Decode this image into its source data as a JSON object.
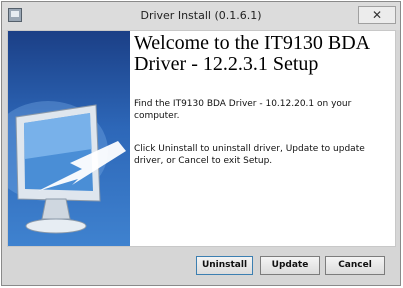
{
  "window": {
    "title": "Driver Install (0.1.6.1)",
    "close_label": "✕"
  },
  "content": {
    "heading": "Welcome to the IT9130 BDA Driver - 12.2.3.1 Setup",
    "find_message": "Find the IT9130 BDA Driver - 10.12.20.1 on your computer.",
    "instruction": "Click Uninstall to uninstall driver, Update to update driver, or Cancel to exit Setup."
  },
  "buttons": {
    "uninstall": "Uninstall",
    "update": "Update",
    "cancel": "Cancel"
  },
  "colors": {
    "side_panel": "#2d67b8",
    "window_bg": "#d6d6d6"
  }
}
